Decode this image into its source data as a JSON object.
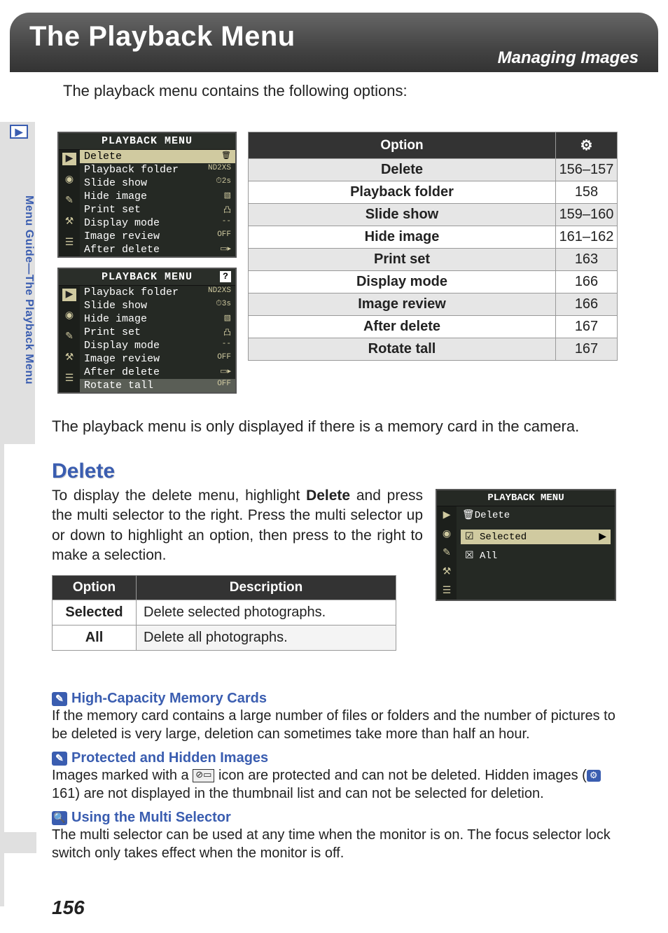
{
  "header": {
    "title": "The Playback Menu",
    "subtitle": "Managing Images"
  },
  "intro": "The playback menu contains the following options:",
  "sidebar_tab": "Menu Guide—The Playback Menu",
  "menu1": {
    "title": "PLAYBACK MENU",
    "items": [
      {
        "label": "Delete",
        "val": "🗑",
        "hl": true
      },
      {
        "label": "Playback folder",
        "val": "ND2XS"
      },
      {
        "label": "Slide show",
        "val": "⏱2s"
      },
      {
        "label": "Hide image",
        "val": "▧"
      },
      {
        "label": "Print set",
        "val": "凸"
      },
      {
        "label": "Display mode",
        "val": "--"
      },
      {
        "label": "Image review",
        "val": "OFF"
      },
      {
        "label": "After delete",
        "val": "▭▸"
      }
    ]
  },
  "menu2": {
    "title": "PLAYBACK MENU",
    "help": "?",
    "items": [
      {
        "label": "Playback folder",
        "val": "ND2XS"
      },
      {
        "label": "Slide show",
        "val": "⏱3s"
      },
      {
        "label": "Hide image",
        "val": "▧"
      },
      {
        "label": "Print set",
        "val": "凸"
      },
      {
        "label": "Display mode",
        "val": "--"
      },
      {
        "label": "Image review",
        "val": "OFF"
      },
      {
        "label": "After delete",
        "val": "▭▸"
      },
      {
        "label": "Rotate tall",
        "val": "OFF",
        "gray": true
      }
    ]
  },
  "options_header": {
    "option": "Option",
    "page_icon": "⚙"
  },
  "options": [
    {
      "name": "Delete",
      "page": "156–157"
    },
    {
      "name": "Playback folder",
      "page": "158"
    },
    {
      "name": "Slide show",
      "page": "159–160"
    },
    {
      "name": "Hide image",
      "page": "161–162"
    },
    {
      "name": "Print set",
      "page": "163"
    },
    {
      "name": "Display mode",
      "page": "166"
    },
    {
      "name": "Image review",
      "page": "166"
    },
    {
      "name": "After delete",
      "page": "167"
    },
    {
      "name": "Rotate tall",
      "page": "167"
    }
  ],
  "after_menus_note": "The playback menu is only displayed if there is a memory card in the camera.",
  "delete_section": {
    "heading": "Delete",
    "para_prefix": "To display the delete menu, highlight ",
    "para_bold": "Delete",
    "para_suffix": " and press the multi selector to the right.  Press the multi selector up or down to highlight an option, then press to the right to make a selection."
  },
  "delete_menu": {
    "title": "PLAYBACK MENU",
    "subtitle": "🗑Delete",
    "selected": "Selected",
    "all": "All"
  },
  "delete_table_header": {
    "option": "Option",
    "desc": "Description"
  },
  "delete_table": [
    {
      "opt": "Selected",
      "desc": "Delete selected photographs."
    },
    {
      "opt": "All",
      "desc": "Delete all photographs."
    }
  ],
  "notes": {
    "n1_title": "High-Capacity Memory Cards",
    "n1_text": "If the memory card contains a large number of files or folders and the number of pictures to be deleted is very large, deletion can sometimes take more than half an hour.",
    "n2_title": "Protected and Hidden Images",
    "n2_text_a": "Images marked with a ",
    "n2_text_b": " icon are protected and can not be deleted.  Hidden images (",
    "n2_text_c": " 161) are not displayed in the thumbnail list and can not be selected for deletion.",
    "n3_title": "Using the Multi Selector",
    "n3_text": "The multi selector can be used at any time when the monitor is on.  The focus selector lock switch only takes effect when the monitor is off."
  },
  "page_number": "156"
}
